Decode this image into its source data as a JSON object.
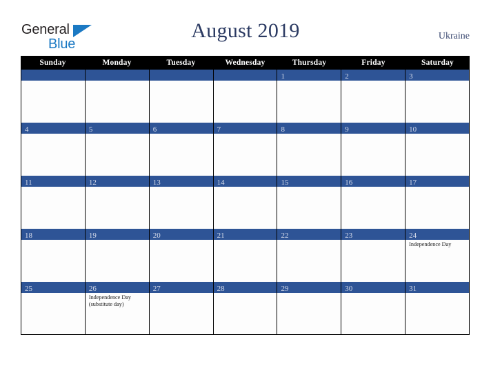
{
  "brand": {
    "name_part1": "General",
    "name_part2": "Blue",
    "triangle_icon": "triangle-icon",
    "accent_color": "#1b79c3",
    "text_color": "#231f20"
  },
  "header": {
    "title": "August 2019",
    "region": "Ukraine",
    "title_color": "#2b3a62"
  },
  "calendar": {
    "header_bg": "#000000",
    "daybar_bg": "#2e5496",
    "daynum_color": "#d7dcea",
    "weekdays": [
      "Sunday",
      "Monday",
      "Tuesday",
      "Wednesday",
      "Thursday",
      "Friday",
      "Saturday"
    ],
    "weeks": [
      [
        {
          "day": ""
        },
        {
          "day": ""
        },
        {
          "day": ""
        },
        {
          "day": ""
        },
        {
          "day": "1"
        },
        {
          "day": "2"
        },
        {
          "day": "3"
        }
      ],
      [
        {
          "day": "4"
        },
        {
          "day": "5"
        },
        {
          "day": "6"
        },
        {
          "day": "7"
        },
        {
          "day": "8"
        },
        {
          "day": "9"
        },
        {
          "day": "10"
        }
      ],
      [
        {
          "day": "11"
        },
        {
          "day": "12"
        },
        {
          "day": "13"
        },
        {
          "day": "14"
        },
        {
          "day": "15"
        },
        {
          "day": "16"
        },
        {
          "day": "17"
        }
      ],
      [
        {
          "day": "18"
        },
        {
          "day": "19"
        },
        {
          "day": "20"
        },
        {
          "day": "21"
        },
        {
          "day": "22"
        },
        {
          "day": "23"
        },
        {
          "day": "24",
          "event": "Independence Day"
        }
      ],
      [
        {
          "day": "25"
        },
        {
          "day": "26",
          "event": "Independence Day (substitute day)"
        },
        {
          "day": "27"
        },
        {
          "day": "28"
        },
        {
          "day": "29"
        },
        {
          "day": "30"
        },
        {
          "day": "31"
        }
      ]
    ]
  }
}
